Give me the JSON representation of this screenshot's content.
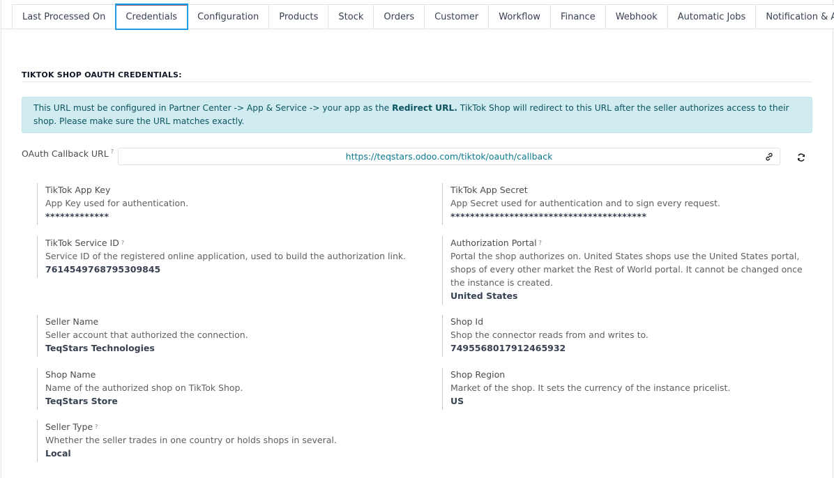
{
  "tabs": [
    {
      "label": "Last Processed On"
    },
    {
      "label": "Credentials"
    },
    {
      "label": "Configuration"
    },
    {
      "label": "Products"
    },
    {
      "label": "Stock"
    },
    {
      "label": "Orders"
    },
    {
      "label": "Customer"
    },
    {
      "label": "Workflow"
    },
    {
      "label": "Finance"
    },
    {
      "label": "Webhook"
    },
    {
      "label": "Automatic Jobs"
    },
    {
      "label": "Notification & Alerts"
    }
  ],
  "active_tab": "Credentials",
  "section": {
    "title": "TIKTOK SHOP OAUTH CREDENTIALS:"
  },
  "alert": {
    "text_before": "This URL must be configured in Partner Center -> App & Service -> your app as the ",
    "bold": "Redirect URL.",
    "text_after": " TikTok Shop will redirect to this URL after the seller authorizes access to their shop. Please make sure the URL matches exactly."
  },
  "callback": {
    "label": "OAuth Callback URL",
    "help": "?",
    "url": "https://teqstars.odoo.com/tiktok/oauth/callback"
  },
  "fields": {
    "app_key": {
      "label": "TikTok App Key",
      "desc": "App Key used for authentication.",
      "value": "*************"
    },
    "app_secret": {
      "label": "TikTok App Secret",
      "desc": "App Secret used for authentication and to sign every request.",
      "value": "****************************************"
    },
    "service_id": {
      "label": "TikTok Service ID",
      "help": "?",
      "desc": "Service ID of the registered online application, used to build the authorization link.",
      "value": "7614549768795309845"
    },
    "auth_portal": {
      "label": "Authorization Portal",
      "help": "?",
      "desc": "Portal the shop authorizes on. United States shops use the United States portal, shops of every other market the Rest of World portal. It cannot be changed once the instance is created.",
      "value": "United States"
    },
    "seller_name": {
      "label": "Seller Name",
      "desc": "Seller account that authorized the connection.",
      "value": "TeqStars Technologies"
    },
    "shop_id": {
      "label": "Shop Id",
      "desc": "Shop the connector reads from and writes to.",
      "value": "7495568017912465932"
    },
    "shop_name": {
      "label": "Shop Name",
      "desc": "Name of the authorized shop on TikTok Shop.",
      "value": "TeqStars Store"
    },
    "shop_region": {
      "label": "Shop Region",
      "desc": "Market of the shop. It sets the currency of the instance pricelist.",
      "value": "US"
    },
    "seller_type": {
      "label": "Seller Type",
      "help": "?",
      "desc": "Whether the seller trades in one country or holds shops in several.",
      "value": "Local"
    }
  },
  "colors": {
    "accent": "#714b67",
    "focus": "#1a9fe6",
    "alert_bg": "#d1ecf1",
    "link": "#0b7a8f"
  }
}
